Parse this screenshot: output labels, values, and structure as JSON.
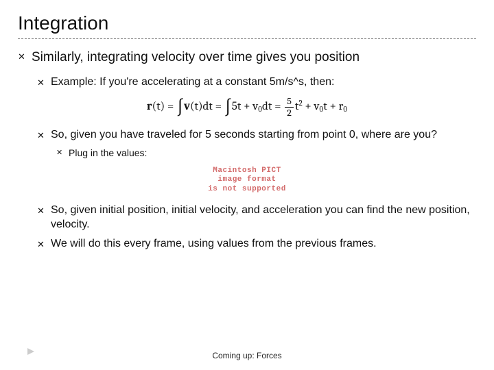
{
  "title": "Integration",
  "body": {
    "p1": "Similarly, integrating velocity over time gives you position",
    "p2": "Example: If you're accelerating at a constant 5m/s^s, then:",
    "eq": {
      "lhs": "r",
      "lhs_arg": "(t) = ",
      "int1_sym": "∫",
      "int1_body": "v",
      "int1_arg": "(t)dt = ",
      "int2_sym": "∫",
      "int2_body": "5t + v",
      "int2_sub": "0",
      "int2_tail": "dt = ",
      "frac_num": "5",
      "frac_den": "2",
      "term_t": "t",
      "term_t_sup": "2",
      "plus1": " + v",
      "v0_sub": "0",
      "v0_tail": "t + r",
      "r0_sub": "0"
    },
    "p3": "So, given you have traveled for 5 seconds starting from point 0, where are you?",
    "p4": "Plug in the values:",
    "error": {
      "l1": "Macintosh PICT",
      "l2": "image format",
      "l3": "is not supported"
    },
    "p5": "So, given initial position, initial velocity, and acceleration you can find the new position, velocity.",
    "p6": "We will do this every frame, using values from the previous frames."
  },
  "footer": "Coming up: Forces",
  "bullet_glyph": "✕"
}
